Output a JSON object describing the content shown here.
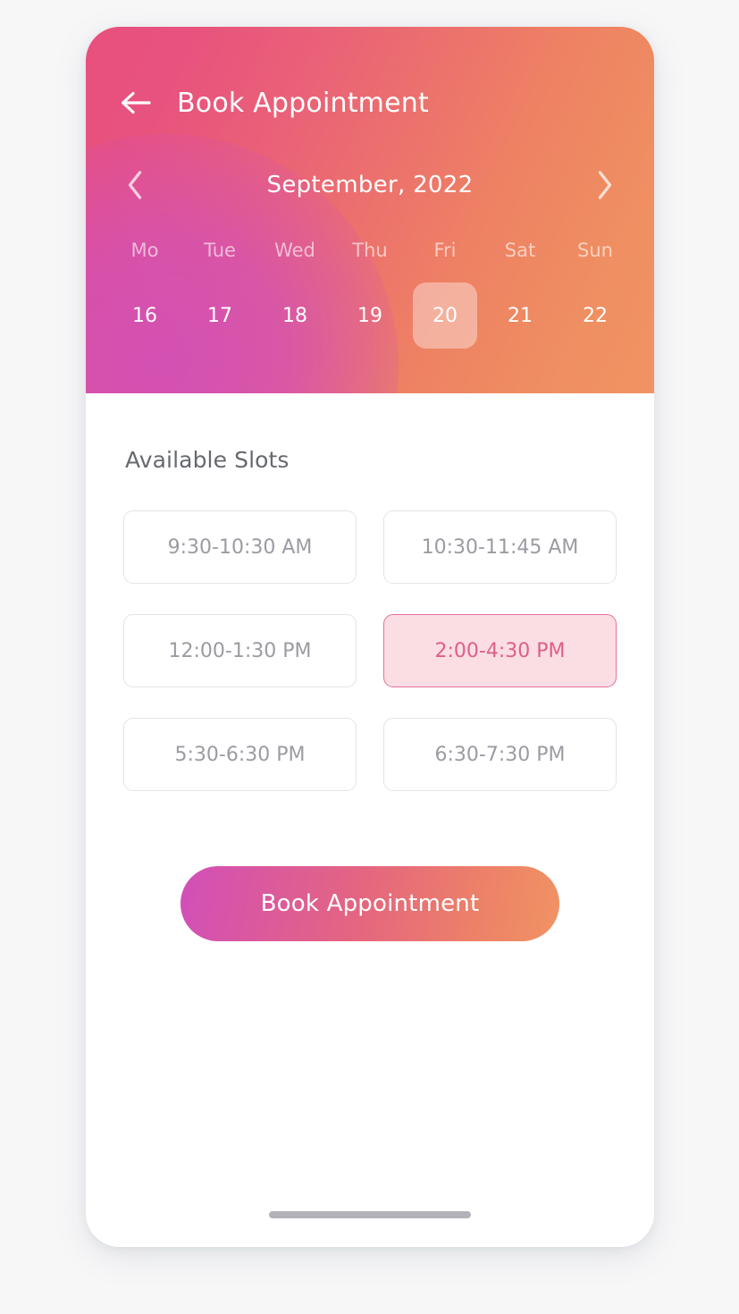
{
  "theme": {
    "gradient_start": "#e8507d",
    "gradient_end": "#f09362",
    "magenta_bloom": "#d14fb9",
    "selected_slot_bg": "#fbdde4",
    "selected_slot_border": "#e4739a",
    "selected_slot_text": "#dd5f89",
    "slot_border": "#e4e4e8",
    "slot_text": "#9b9ba2",
    "section_title_color": "#67696f",
    "page_background": "#f7f7f8",
    "home_indicator_color": "#b2b2b8"
  },
  "header": {
    "back_icon": "arrow-left-icon",
    "title": "Book Appointment"
  },
  "calendar": {
    "prev_icon": "chevron-left-icon",
    "next_icon": "chevron-right-icon",
    "month_label": "September, 2022",
    "weekdays": [
      "Mo",
      "Tue",
      "Wed",
      "Thu",
      "Fri",
      "Sat",
      "Sun"
    ],
    "dates": [
      "16",
      "17",
      "18",
      "19",
      "20",
      "21",
      "22"
    ],
    "selected_date": "20",
    "selected_index": 4
  },
  "slots_section": {
    "title": "Available Slots",
    "slots": [
      {
        "label": "9:30-10:30 AM",
        "selected": false
      },
      {
        "label": "10:30-11:45 AM",
        "selected": false
      },
      {
        "label": "12:00-1:30 PM",
        "selected": false
      },
      {
        "label": "2:00-4:30 PM",
        "selected": true
      },
      {
        "label": "5:30-6:30 PM",
        "selected": false
      },
      {
        "label": "6:30-7:30 PM",
        "selected": false
      }
    ],
    "selected_slot": "2:00-4:30 PM"
  },
  "cta": {
    "label": "Book Appointment"
  }
}
